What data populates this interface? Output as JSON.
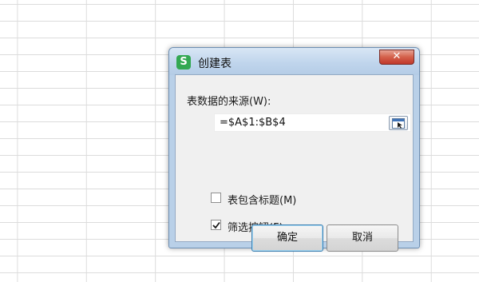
{
  "dialog": {
    "title": "创建表",
    "app_icon_letter": "S",
    "close_symbol": "✕",
    "source_label": "表数据的来源(W):",
    "range_value": "=$A$1:$B$4",
    "options": [
      {
        "label": "表包含标题(M)",
        "checked": false
      },
      {
        "label": "筛选按钮(F)",
        "checked": true
      }
    ],
    "ok_label": "确定",
    "cancel_label": "取消"
  }
}
